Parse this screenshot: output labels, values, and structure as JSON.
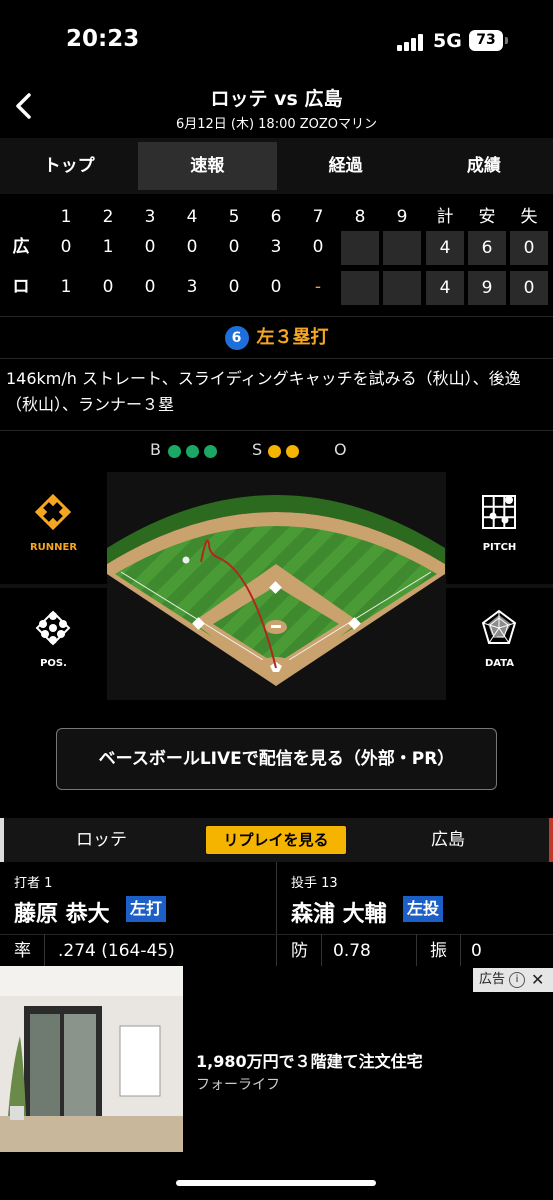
{
  "status": {
    "time": "20:23",
    "network": "5G",
    "battery": "73"
  },
  "header": {
    "title": "ロッテ vs 広島",
    "subtitle": "6月12日 (木) 18:00 ZOZOマリン"
  },
  "tabs": [
    {
      "label": "トップ",
      "active": false
    },
    {
      "label": "速報",
      "active": true
    },
    {
      "label": "経過",
      "active": false
    },
    {
      "label": "成績",
      "active": false
    }
  ],
  "scoreboard": {
    "headers": [
      "1",
      "2",
      "3",
      "4",
      "5",
      "6",
      "7",
      "8",
      "9",
      "計",
      "安",
      "失"
    ],
    "rows": [
      {
        "team": "広",
        "innings": [
          "0",
          "1",
          "0",
          "0",
          "0",
          "3",
          "0",
          "",
          ""
        ],
        "totals": [
          "4",
          "6",
          "0"
        ]
      },
      {
        "team": "ロ",
        "innings": [
          "1",
          "0",
          "0",
          "3",
          "0",
          "0",
          "-",
          "",
          ""
        ],
        "totals": [
          "4",
          "9",
          "0"
        ]
      }
    ]
  },
  "play": {
    "number": "6",
    "result": "左３塁打"
  },
  "description": "146km/h ストレート、スライディングキャッチを試みる（秋山）、後逸（秋山）、ランナー３塁",
  "count": {
    "b_label": "B",
    "balls": 3,
    "s_label": "S",
    "strikes": 2,
    "o_label": "O",
    "outs": 0,
    "ball_color": "#1aa864",
    "strike_color": "#f5b400"
  },
  "views": {
    "runner": "RUNNER",
    "pos": "POS.",
    "pitch": "PITCH",
    "data": "DATA"
  },
  "live_button": "ベースボールLIVEで配信を見る（外部・PR）",
  "team_bar": {
    "left": "ロッテ",
    "replay": "リプレイを見る",
    "right": "広島"
  },
  "batter": {
    "role": "打者 1",
    "name": "藤原 恭大",
    "hand": "左打",
    "stat_label": "率",
    "stat_value": ".274 (164-45)"
  },
  "pitcher": {
    "role": "投手 13",
    "name": "森浦 大輔",
    "hand": "左投",
    "stat1_label": "防",
    "stat1_value": "0.78",
    "stat2_label": "振",
    "stat2_value": "0"
  },
  "ad": {
    "badge": "広告",
    "title": "1,980万円で３階建て注文住宅",
    "sponsor": "フォーライフ"
  },
  "colors": {
    "accent": "#f5a623",
    "tab_active": "#2e2e2e",
    "hand_badge": "#1c5fc7"
  }
}
